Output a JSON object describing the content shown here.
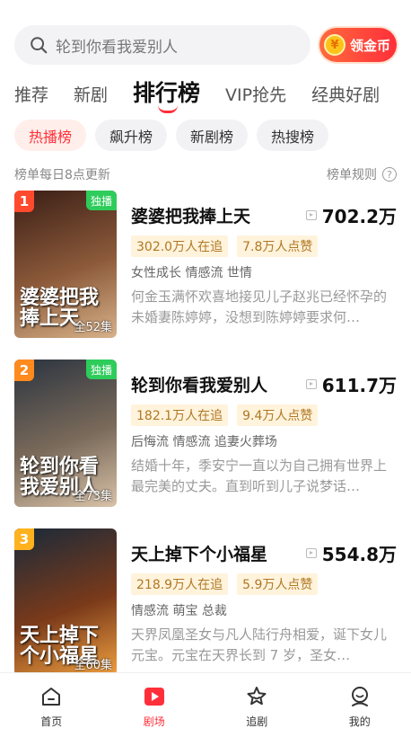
{
  "search": {
    "placeholder": "轮到你看我爱别人"
  },
  "coin_button": {
    "icon_char": "¥",
    "label": "领金币"
  },
  "tabs": [
    {
      "label": "推荐",
      "active": false
    },
    {
      "label": "新剧",
      "active": false
    },
    {
      "label": "排行榜",
      "active": true
    },
    {
      "label": "VIP抢先",
      "active": false
    },
    {
      "label": "经典好剧",
      "active": false
    }
  ],
  "chips": [
    {
      "label": "热播榜",
      "active": true
    },
    {
      "label": "飙升榜",
      "active": false
    },
    {
      "label": "新剧榜",
      "active": false
    },
    {
      "label": "热搜榜",
      "active": false
    }
  ],
  "meta": {
    "update_note": "榜单每日8点更新",
    "rules_label": "榜单规则",
    "help_char": "?"
  },
  "items": [
    {
      "rank": "1",
      "rank_color": "#ff4a2e",
      "badge": "独播",
      "poster_title": "婆婆把我捧上天",
      "episodes": "全52集",
      "title": "婆婆把我捧上天",
      "heat": "702.2万",
      "watching": "302.0万人在追",
      "likes": "7.8万人点赞",
      "genres": "女性成长 情感流 世情",
      "desc": "何金玉满怀欢喜地接见儿子赵兆已经怀孕的未婚妻陈婷婷，没想到陈婷婷要求何…",
      "poster_colors": [
        "#3a1e16",
        "#8c5a3a",
        "#d7b28a"
      ]
    },
    {
      "rank": "2",
      "rank_color": "#ff8a1e",
      "badge": "独播",
      "poster_title": "轮到你看我爱别人",
      "episodes": "全73集",
      "title": "轮到你看我爱别人",
      "heat": "611.7万",
      "watching": "182.1万人在追",
      "likes": "9.4万人点赞",
      "genres": "后悔流 情感流 追妻火葬场",
      "desc": "结婚十年，季安宁一直以为自己拥有世界上最完美的丈夫。直到听到儿子说梦话…",
      "poster_colors": [
        "#2b3440",
        "#7a6a5a",
        "#d8c2a8"
      ]
    },
    {
      "rank": "3",
      "rank_color": "#ffb21e",
      "badge": "",
      "poster_title": "天上掉下个小福星",
      "episodes": "全60集",
      "title": "天上掉下个小福星",
      "heat": "554.8万",
      "watching": "218.9万人在追",
      "likes": "5.9万人点赞",
      "genres": "情感流 萌宝 总裁",
      "desc": "天界凤凰圣女与凡人陆行舟相爱，诞下女儿元宝。元宝在天界长到 7 岁，圣女…",
      "poster_colors": [
        "#1a2a3a",
        "#7a3a1a",
        "#f0a040"
      ]
    }
  ],
  "bottom_nav": [
    {
      "label": "首页",
      "icon": "home-icon",
      "active": false
    },
    {
      "label": "剧场",
      "icon": "theater-play-icon",
      "active": true
    },
    {
      "label": "追剧",
      "icon": "star-follow-icon",
      "active": false
    },
    {
      "label": "我的",
      "icon": "profile-icon",
      "active": false
    }
  ],
  "colors": {
    "accent": "#ff2f3a",
    "tag_bg": "#fff3dc",
    "tag_text": "#b07824",
    "exclusive": "#2ecc5b"
  }
}
